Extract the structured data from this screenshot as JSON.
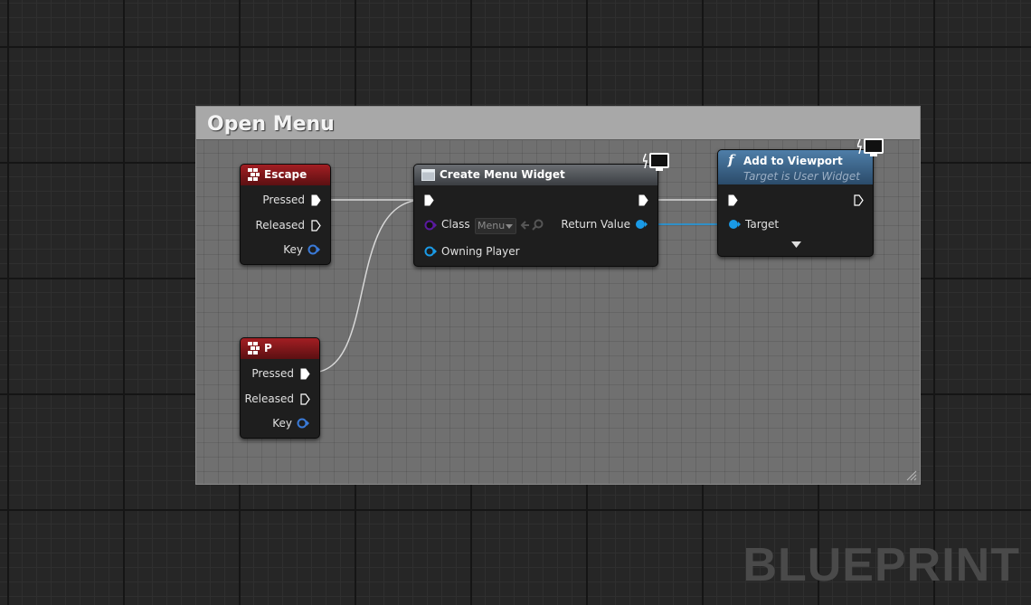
{
  "comment": {
    "title": "Open Menu"
  },
  "nodes": {
    "escape": {
      "title": "Escape",
      "pressed": "Pressed",
      "released": "Released",
      "key": "Key"
    },
    "p": {
      "title": "P",
      "pressed": "Pressed",
      "released": "Released",
      "key": "Key"
    },
    "create_widget": {
      "title": "Create Menu Widget",
      "class_label": "Class",
      "class_value": "Menu",
      "owning_player": "Owning Player",
      "return_value": "Return Value"
    },
    "add_to_viewport": {
      "title": "Add to Viewport",
      "subtitle": "Target is User Widget",
      "target": "Target"
    }
  },
  "watermark": "BLUEPRINT",
  "colors": {
    "exec": "#ffffff",
    "object_pin": "#1a9ae6",
    "class_pin": "#5a1aa0",
    "key_pin": "#3a7ad8",
    "event_header": "#a31e23",
    "function_header": "#4e7ea8"
  }
}
